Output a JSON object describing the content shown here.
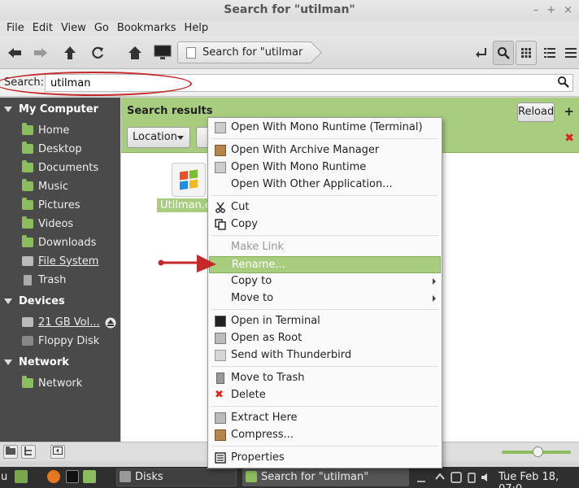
{
  "window": {
    "title": "Search for \"utilman\"",
    "controls": [
      "–",
      "+",
      "×"
    ]
  },
  "menubar": [
    "File",
    "Edit",
    "View",
    "Go",
    "Bookmarks",
    "Help"
  ],
  "toolbar": {
    "path_button": "Search for \"utilman\"",
    "icons": [
      "back-arrow-icon",
      "forward-arrow-icon",
      "up-arrow-icon",
      "reload-icon",
      "home-icon",
      "computer-icon",
      "path-toggle-icon",
      "search-icon",
      "icon-view-icon",
      "list-view-icon",
      "compact-view-icon"
    ]
  },
  "search": {
    "label": "Search:",
    "value": "utilman"
  },
  "sidebar": {
    "sections": [
      {
        "title": "My Computer",
        "items": [
          "Home",
          "Desktop",
          "Documents",
          "Music",
          "Pictures",
          "Videos",
          "Downloads",
          "File System",
          "Trash"
        ]
      },
      {
        "title": "Devices",
        "items": [
          "21 GB Vol...",
          "Floppy Disk"
        ]
      },
      {
        "title": "Network",
        "items": [
          "Network"
        ]
      }
    ]
  },
  "main": {
    "header": "Search results",
    "reload": "Reload",
    "location": "Location",
    "file": {
      "label": "Utilman.e",
      "icon": "windows-exe-icon"
    }
  },
  "context_menu": {
    "items": [
      {
        "label": "Open With Mono Runtime (Terminal)",
        "icon": "mono-icon"
      },
      {
        "label": "Open With Archive Manager",
        "icon": "archive-icon"
      },
      {
        "label": "Open With Mono Runtime",
        "icon": "mono-icon"
      },
      {
        "label": "Open With Other Application...",
        "icon": ""
      },
      {
        "label": "Cut",
        "icon": "scissors-icon"
      },
      {
        "label": "Copy",
        "icon": "copy-icon"
      },
      {
        "label": "Make Link",
        "icon": "",
        "disabled": true
      },
      {
        "label": "Rename...",
        "icon": "",
        "highlighted": true
      },
      {
        "label": "Copy to",
        "icon": "",
        "submenu": true
      },
      {
        "label": "Move to",
        "icon": "",
        "submenu": true
      },
      {
        "label": "Open in Terminal",
        "icon": "terminal-icon"
      },
      {
        "label": "Open as Root",
        "icon": "root-icon"
      },
      {
        "label": "Send with Thunderbird",
        "icon": "mail-icon"
      },
      {
        "label": "Move to Trash",
        "icon": "trash-icon"
      },
      {
        "label": "Delete",
        "icon": "delete-icon"
      },
      {
        "label": "Extract Here",
        "icon": "extract-icon"
      },
      {
        "label": "Compress...",
        "icon": "compress-icon"
      },
      {
        "label": "Properties",
        "icon": "properties-icon"
      }
    ]
  },
  "taskbar": {
    "menu_fragment": "u",
    "windows": [
      "Disks",
      "Search for \"utilman\""
    ],
    "clock": "Tue Feb 18, 07:0"
  },
  "colors": {
    "accent": "#a8cd7f",
    "sidebar_bg": "#4a4a4a",
    "annotation_red": "#c42828"
  }
}
